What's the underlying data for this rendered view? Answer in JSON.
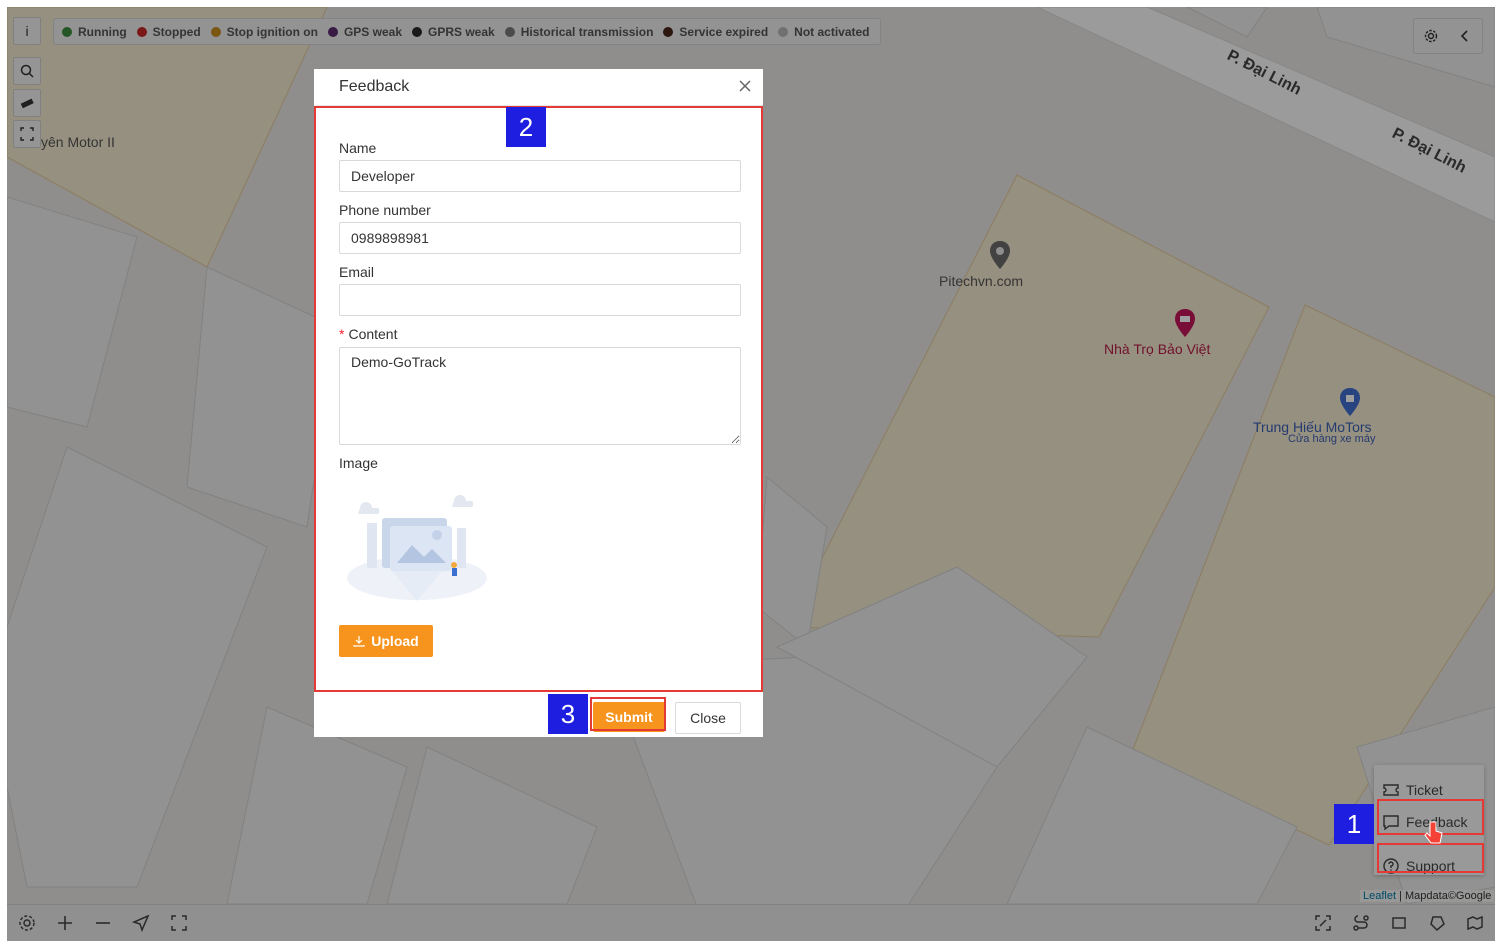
{
  "toolbar_left": {
    "info_label": "i"
  },
  "legend": [
    {
      "label": "Running",
      "color": "#3a8a3a"
    },
    {
      "label": "Stopped",
      "color": "#c62828"
    },
    {
      "label": "Stop ignition on",
      "color": "#c98a1e"
    },
    {
      "label": "GPS weak",
      "color": "#5b2a6e"
    },
    {
      "label": "GPRS weak",
      "color": "#2a2a2a"
    },
    {
      "label": "Historical transmission",
      "color": "#7a7a7a"
    },
    {
      "label": "Service expired",
      "color": "#4a2418"
    },
    {
      "label": "Not activated",
      "color": "#b5b5b5"
    }
  ],
  "map": {
    "labels": {
      "motor": "yên Motor II",
      "pitech": "Pitechvn.com",
      "nhatro": "Nhà Trọ Bảo Việt",
      "trunghieu": "Trung Hiếu MoTors",
      "trunghieu_sub": "Cửa hàng xe máy",
      "street1": "P. Đại Linh",
      "street2": "P. Đại Linh"
    },
    "attribution_link": "Leaflet",
    "attribution_text": "Mapdata©Google"
  },
  "help_menu": {
    "ticket": "Ticket",
    "feedback": "Feedback",
    "support": "Support"
  },
  "badges": {
    "one": "1",
    "two": "2",
    "three": "3"
  },
  "modal": {
    "title": "Feedback",
    "name_label": "Name",
    "name_value": "Developer",
    "phone_label": "Phone number",
    "phone_value": "0989898981",
    "email_label": "Email",
    "email_value": "",
    "content_required": "*",
    "content_label": "Content",
    "content_value": "Demo-GoTrack",
    "image_label": "Image",
    "upload_label": "Upload",
    "submit_label": "Submit",
    "close_label": "Close"
  },
  "colors": {
    "accent": "#f7941d",
    "highlight": "#e53935",
    "badge": "#1e1ee0"
  }
}
